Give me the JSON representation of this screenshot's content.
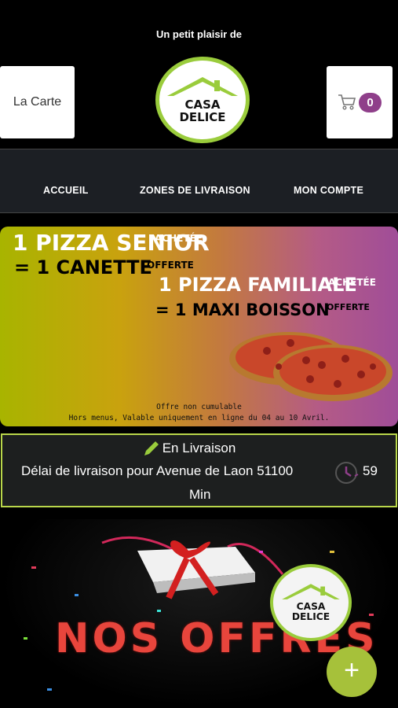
{
  "header": {
    "tagline": "Un petit plaisir de",
    "carte_label": "La Carte",
    "logo_text_line1": "CASA",
    "logo_text_line2": "DELICE",
    "cart_count": "0"
  },
  "nav": {
    "items": [
      "ACCUEIL",
      "ZONES DE LIVRAISON",
      "MON COMPTE"
    ]
  },
  "promo": {
    "line1_big": "1 PIZZA SENIOR",
    "line1_small": "ACHETÉE",
    "line2_big": "= 1 CANETTE",
    "line2_small": "OFFERTE",
    "line3_big": "1 PIZZA FAMILIALE",
    "line3_small": "ACHETÉE",
    "line4_big": "= 1 MAXI BOISSON",
    "line4_small": "OFFERTE",
    "footnote1": "Offre non cumulable",
    "footnote2": "Hors menus, Valable uniquement en ligne du 04 au 10 Avril."
  },
  "delivery": {
    "status": "En Livraison",
    "text": "Délai de livraison pour Avenue de Laon 51100",
    "minutes": "59",
    "unit": "Min"
  },
  "offers": {
    "title": "NOS OFFRES"
  },
  "colors": {
    "accent_green": "#9acc3c",
    "badge_purple": "#8f3f8a",
    "offers_red": "#e8453c"
  },
  "icons": [
    "cart-icon",
    "pencil-icon",
    "clock-icon",
    "plus-icon",
    "house-roof-icon"
  ]
}
